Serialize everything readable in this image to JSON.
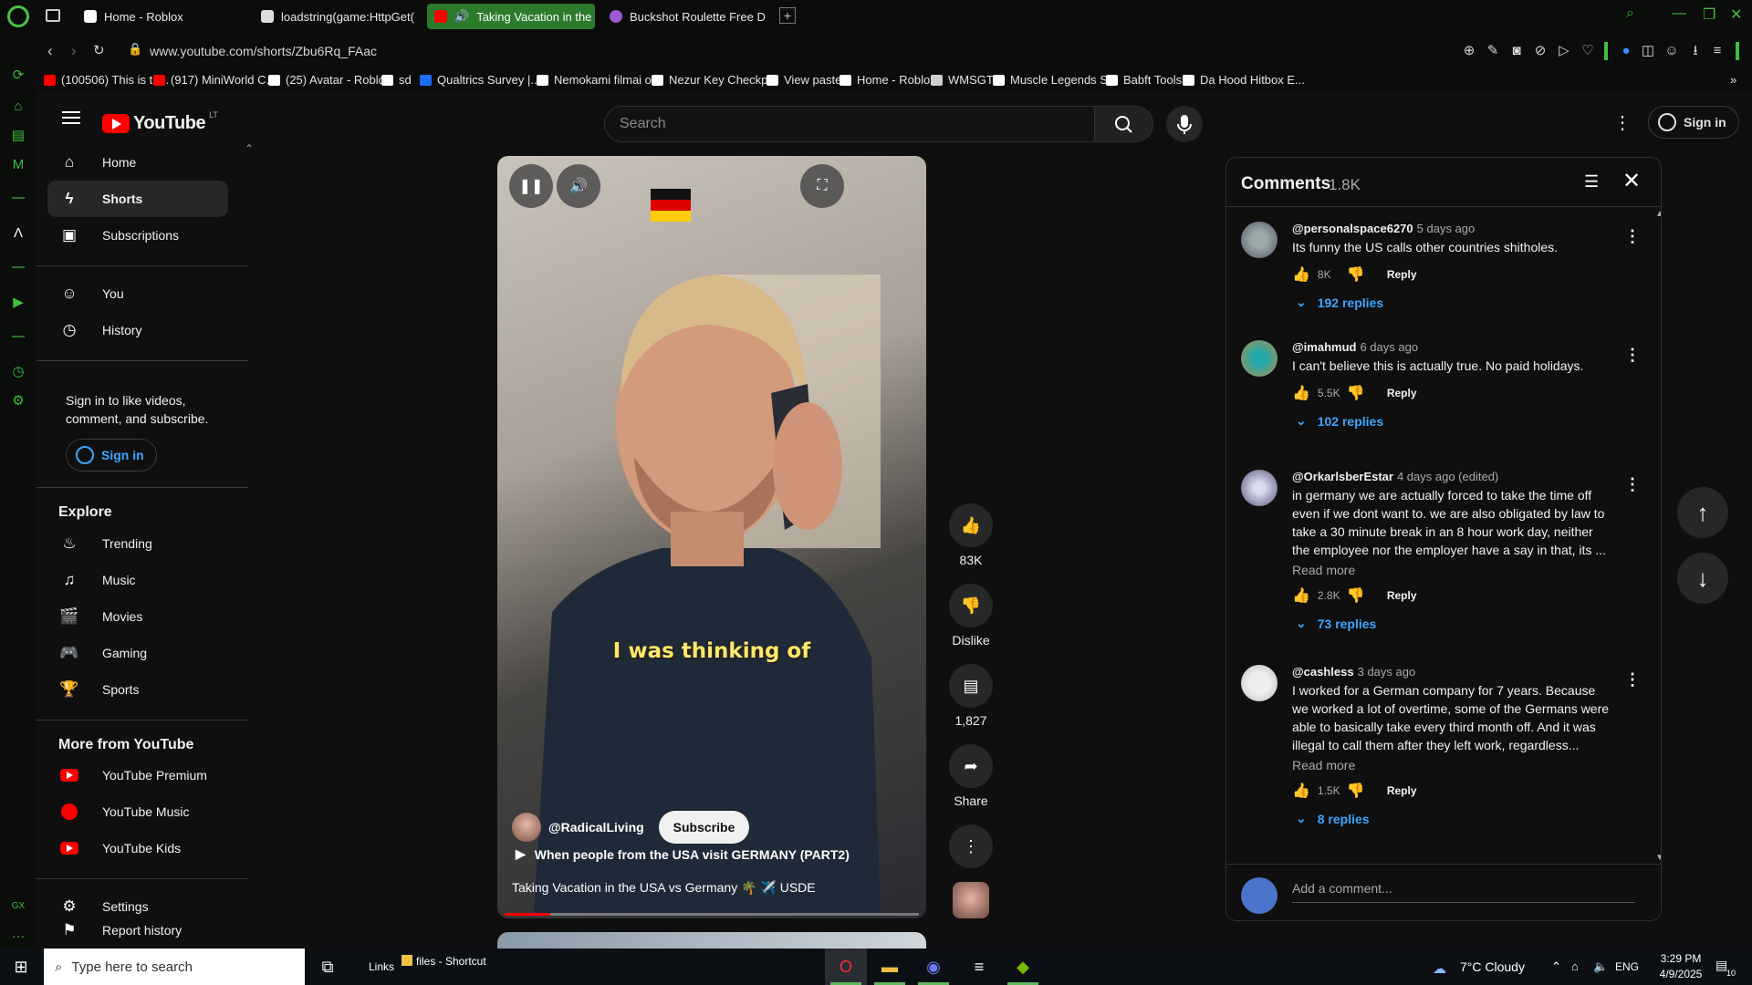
{
  "browser": {
    "tabs": [
      {
        "title": "Home - Roblox",
        "color": "#ffffff"
      },
      {
        "title": "loadstring(game:HttpGet(",
        "color": "#ffffff"
      },
      {
        "title": "Taking Vacation in the",
        "color": "#ff0000",
        "active": true
      },
      {
        "title": "Buckshot Roulette Free D",
        "color": "#9b59d0"
      }
    ],
    "new_tab": "+",
    "url": "www.youtube.com/shorts/Zbu6Rq_FAac",
    "bookmarks": [
      {
        "label": "(100506) This is th...",
        "color": "#ff0000"
      },
      {
        "label": "(917) MiniWorld C...",
        "color": "#ff0000"
      },
      {
        "label": "(25) Avatar - Roblox",
        "color": "#ffffff"
      },
      {
        "label": "sd",
        "color": "#ffffff"
      },
      {
        "label": "Qualtrics Survey |...",
        "color": "#1b6ef3"
      },
      {
        "label": "Nemokami filmai o...",
        "color": "#ffffff"
      },
      {
        "label": "Nezur Key Checkp...",
        "color": "#ffffff"
      },
      {
        "label": "View paste",
        "color": "#ffffff"
      },
      {
        "label": "Home - Roblox",
        "color": "#ffffff"
      },
      {
        "label": "WMSGT",
        "color": "#d0d0d0"
      },
      {
        "label": "Muscle Legends S...",
        "color": "#ffffff"
      },
      {
        "label": "Babft Tools",
        "color": "#ffffff"
      },
      {
        "label": "Da Hood Hitbox E...",
        "color": "#ffffff"
      }
    ],
    "accent": "#3fbf3f"
  },
  "youtube": {
    "logo": "YouTube",
    "country": "LT",
    "search_placeholder": "Search",
    "sign_in": "Sign in",
    "guide": {
      "main": [
        "Home",
        "Shorts",
        "Subscriptions"
      ],
      "you": [
        "You",
        "History"
      ],
      "signin_prompt": "Sign in to like videos, comment, and subscribe.",
      "signin_button": "Sign in",
      "explore_title": "Explore",
      "explore": [
        "Trending",
        "Music",
        "Movies",
        "Gaming",
        "Sports"
      ],
      "more_title": "More from YouTube",
      "more": [
        "YouTube Premium",
        "YouTube Music",
        "YouTube Kids"
      ],
      "settings": [
        "Settings",
        "Report history"
      ]
    },
    "short": {
      "caption": "I was thinking of",
      "channel": "@RadicalLiving",
      "subscribe": "Subscribe",
      "playlist": "When people from the USA visit GERMANY (PART2)",
      "title": "Taking Vacation in the USA vs Germany 🌴 ✈️ USDE",
      "progress": 0.11
    },
    "actions": {
      "likes": "83K",
      "dislike": "Dislike",
      "comments": "1,827",
      "share": "Share"
    },
    "comments_panel": {
      "title": "Comments",
      "count": "1.8K",
      "add_placeholder": "Add a comment...",
      "items": [
        {
          "author": "@personalspace6270",
          "time": "5 days ago",
          "text": "Its funny the US calls other countries shitholes.",
          "likes": "8K",
          "reply": "Reply",
          "replies": "192 replies",
          "read_more": ""
        },
        {
          "author": "@imahmud",
          "time": "6 days ago",
          "text": "I can't believe this is actually true. No paid holidays.",
          "likes": "5.5K",
          "reply": "Reply",
          "replies": "102 replies",
          "read_more": ""
        },
        {
          "author": "@OrkarlsberEstar",
          "time": "4 days ago (edited)",
          "text": "in germany we are actually forced to take the time off even if we dont want to. we are also obligated by law to take a 30 minute break in an 8 hour work day, neither the employee nor the employer have a say in that, its ...",
          "likes": "2.8K",
          "reply": "Reply",
          "replies": "73 replies",
          "read_more": "Read more"
        },
        {
          "author": "@cashless",
          "time": "3 days ago",
          "text": "I worked for a German company for 7 years. Because we worked a lot of overtime, some of the Germans were able to basically take every third month off. And it was illegal to call them after they left work, regardless...",
          "likes": "1.5K",
          "reply": "Reply",
          "replies": "8 replies",
          "read_more": "Read more"
        }
      ]
    }
  },
  "taskbar": {
    "search_placeholder": "Type here to search",
    "links": "Links",
    "files": "files - Shortcut",
    "weather": "7°C  Cloudy",
    "lang": "ENG",
    "time": "3:29 PM",
    "date": "4/9/2025",
    "notifications": "10"
  }
}
